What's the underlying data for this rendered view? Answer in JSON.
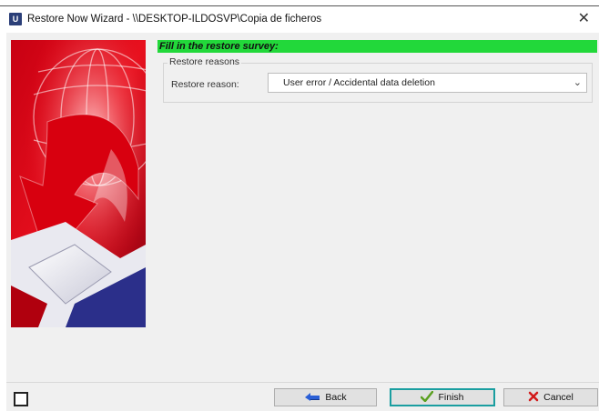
{
  "window": {
    "app_icon_letter": "U",
    "title": "Restore Now Wizard - \\\\DESKTOP-ILDOSVP\\Copia de ficheros",
    "close_icon": "close-icon"
  },
  "survey": {
    "header": "Fill in the restore survey:",
    "group_title": "Restore reasons",
    "reason_label": "Restore reason:",
    "reason_value": "User error / Accidental data deletion"
  },
  "buttons": {
    "back": "Back",
    "finish": "Finish",
    "cancel": "Cancel"
  },
  "colors": {
    "header_bar": "#22d83a",
    "finish_focus_border": "#1a9ea0",
    "client_background": "#f0f0f0"
  },
  "icons": {
    "back": "back-arrow-icon",
    "finish": "checkmark-icon",
    "cancel": "red-x-icon",
    "dropdown": "chevron-down-icon",
    "bottom_left": "square-icon"
  }
}
